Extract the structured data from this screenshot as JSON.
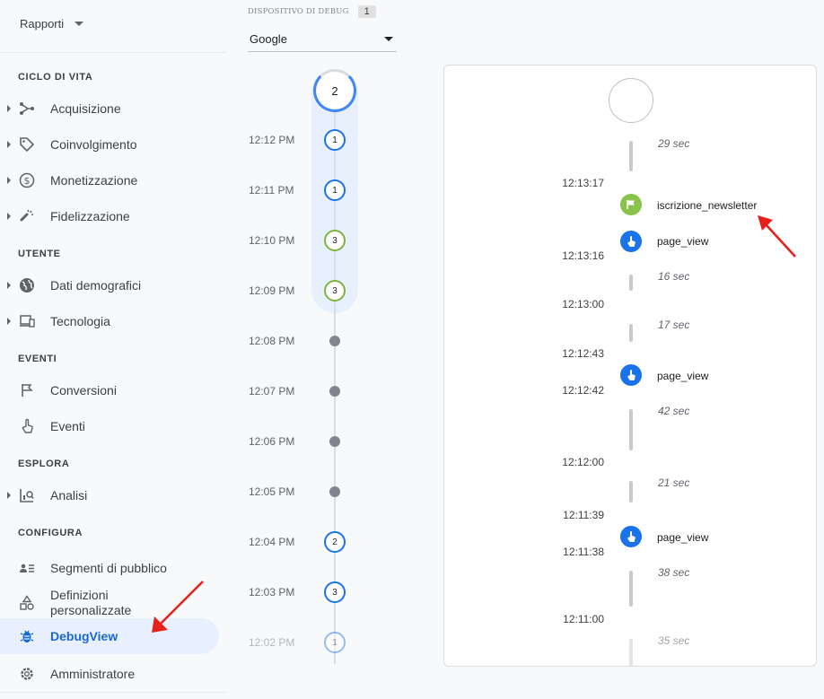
{
  "sidebar": {
    "report_selector": "Rapporti",
    "sections": [
      {
        "title": "CICLO DI VITA",
        "items": [
          "Acquisizione",
          "Coinvolgimento",
          "Monetizzazione",
          "Fidelizzazione"
        ]
      },
      {
        "title": "UTENTE",
        "items": [
          "Dati demografici",
          "Tecnologia"
        ]
      },
      {
        "title": "EVENTI",
        "items": [
          "Conversioni",
          "Eventi"
        ]
      },
      {
        "title": "ESPLORA",
        "items": [
          "Analisi"
        ]
      },
      {
        "title": "CONFIGURA",
        "items": [
          "Segmenti di pubblico",
          "Definizioni personalizzate",
          "DebugView",
          "Amministratore"
        ]
      }
    ],
    "active_item": "DebugView"
  },
  "device": {
    "label": "DISPOSITIVO DI DEBUG",
    "count": "1",
    "selected": "Google"
  },
  "minutes": {
    "top_count": "2",
    "rows": [
      {
        "time": "12:12 PM",
        "count": "1",
        "kind": "blue"
      },
      {
        "time": "12:11 PM",
        "count": "1",
        "kind": "blue"
      },
      {
        "time": "12:10 PM",
        "count": "3",
        "kind": "green"
      },
      {
        "time": "12:09 PM",
        "count": "3",
        "kind": "green"
      },
      {
        "time": "12:08 PM",
        "count": "",
        "kind": "dot"
      },
      {
        "time": "12:07 PM",
        "count": "",
        "kind": "dot"
      },
      {
        "time": "12:06 PM",
        "count": "",
        "kind": "dot"
      },
      {
        "time": "12:05 PM",
        "count": "",
        "kind": "dot"
      },
      {
        "time": "12:04 PM",
        "count": "2",
        "kind": "blue"
      },
      {
        "time": "12:03 PM",
        "count": "3",
        "kind": "blue"
      },
      {
        "time": "12:02 PM",
        "count": "1",
        "kind": "faded"
      }
    ]
  },
  "events": {
    "gaps": [
      "29 sec",
      "16 sec",
      "17 sec",
      "42 sec",
      "21 sec",
      "38 sec",
      "35 sec"
    ],
    "times": [
      "12:13:17",
      "12:13:16",
      "12:13:00",
      "12:12:43",
      "12:12:42",
      "12:12:00",
      "12:11:39",
      "12:11:38",
      "12:11:00"
    ],
    "items": [
      {
        "name": "iscrizione_newsletter",
        "icon": "flag-icon",
        "color": "#8bc34a"
      },
      {
        "name": "page_view",
        "icon": "touch-icon",
        "color": "#1a73e8"
      },
      {
        "name": "page_view",
        "icon": "touch-icon",
        "color": "#1a73e8"
      },
      {
        "name": "page_view",
        "icon": "touch-icon",
        "color": "#1a73e8"
      }
    ]
  },
  "colors": {
    "accent": "#1a73e8",
    "active_bg": "#e8f0fe",
    "conversion": "#8bc34a",
    "annotation": "#e8201b"
  }
}
